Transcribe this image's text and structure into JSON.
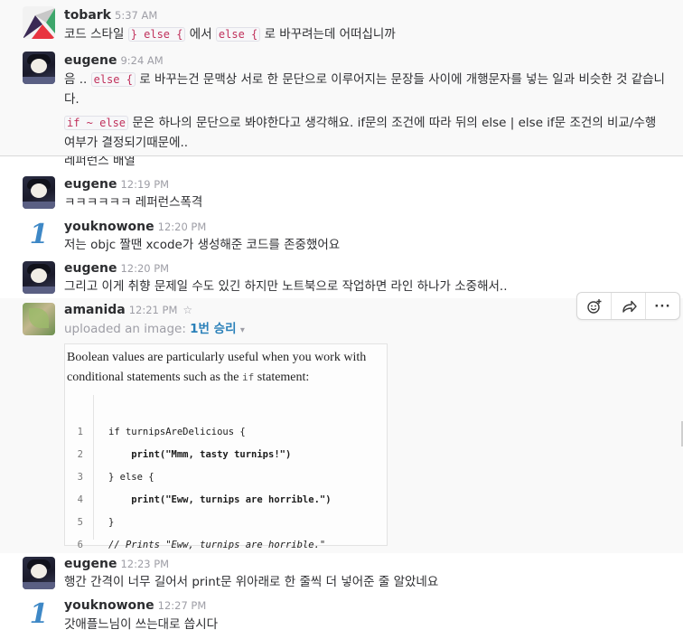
{
  "messages": [
    {
      "id": "m1",
      "author": "tobark",
      "time": "5:37 AM",
      "parts": [
        "코드 스타일 ",
        "} else {",
        " 에서 ",
        "else {",
        " 로 바꾸려는데 어떠십니까"
      ]
    },
    {
      "id": "m2",
      "author": "eugene",
      "time": "9:24 AM",
      "para1_parts": [
        "음 .. ",
        "else {",
        " 로 바꾸는건 문맥상 서로 한 문단으로 이루어지는 문장들 사이에 개행문자를 넣는 일과 비슷한 것 같습니다."
      ],
      "para2_parts": [
        "if ~ else",
        " 문은 하나의 문단으로 봐야한다고 생각해요. if문의 조건에 따라 뒤의 else | else if문 조건의 비교/수행 여부가 결정되기때문에.."
      ]
    },
    {
      "id": "cut",
      "text": "레퍼런스 배열"
    },
    {
      "id": "m3",
      "author": "eugene",
      "time": "12:19 PM",
      "text": "ㅋㅋㅋㅋㅋㅋ 레퍼런스폭격"
    },
    {
      "id": "m4",
      "author": "youknowone",
      "time": "12:20 PM",
      "text": "저는 objc 짤땐 xcode가 생성해준 코드를 존중했어요"
    },
    {
      "id": "m5",
      "author": "eugene",
      "time": "12:20 PM",
      "text": "그리고 이게 취향 문제일 수도 있긴 하지만 노트북으로 작업하면 라인 하나가 소중해서.."
    },
    {
      "id": "m6",
      "author": "amanida",
      "time": "12:21 PM",
      "upload_prefix": "uploaded an image: ",
      "upload_title": "1번 승리",
      "preview_text_a": "Boolean values are particularly useful when you work with conditional statements such as the ",
      "preview_inline_code": "if",
      "preview_text_b": " statement:",
      "code_lines": [
        {
          "n": "1",
          "text": "if turnipsAreDelicious {"
        },
        {
          "n": "2",
          "text": "    print(\"Mmm, tasty turnips!\")"
        },
        {
          "n": "3",
          "text": "} else {"
        },
        {
          "n": "4",
          "text": "    print(\"Eww, turnips are horrible.\")"
        },
        {
          "n": "5",
          "text": "}"
        },
        {
          "n": "6",
          "text": "// Prints \"Eww, turnips are horrible.\""
        }
      ]
    },
    {
      "id": "m7",
      "author": "eugene",
      "time": "12:23 PM",
      "text": "행간 간격이 너무 길어서 print문 위아래로 한 줄씩 더 넣어준 줄 알았네요"
    },
    {
      "id": "m8",
      "author": "youknowone",
      "time": "12:27 PM",
      "text": "갓애플느님이 쓰는대로 씁시다"
    }
  ],
  "actions": {
    "reaction_icon": "add-reaction-icon",
    "share_icon": "share-icon",
    "more_label": "···"
  },
  "icons": {
    "star": "☆",
    "caret": "▾",
    "youknowone_glyph": "1"
  },
  "colors": {
    "link": "#2a80b9",
    "code_text": "#c0305b",
    "youknowone_avatar": "#3e88c6"
  }
}
